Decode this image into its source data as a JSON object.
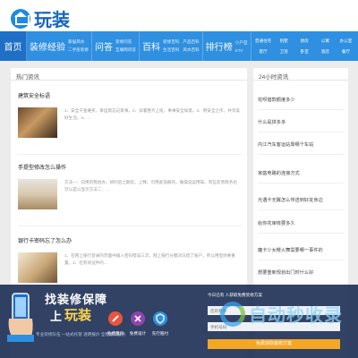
{
  "header": {
    "logo_text": "玩装"
  },
  "nav": {
    "home": "首页",
    "groups": [
      {
        "label": "装修经验",
        "subs": [
          "家居风水",
          "二手房装修"
        ]
      },
      {
        "label": "问答",
        "subs": [
          "装修问答",
          "互联网问答"
        ]
      },
      {
        "label": "百科",
        "subs": [
          "装修百科",
          "生活百科"
        ]
      },
      {
        "label": "",
        "subs": [
          "产品百科",
          "风水百科"
        ]
      },
      {
        "label": "排行榜",
        "subs": [
          "小户型",
          "KTV"
        ]
      }
    ],
    "right_links": [
      "普通住宅",
      "别墅",
      "厨房",
      "公寓",
      "办公室",
      "客厅",
      "卫浴",
      "卧室",
      "酒店",
      "餐厅"
    ]
  },
  "main": {
    "section_title": "热门资讯",
    "articles": [
      {
        "title": "建筑安全标语",
        "desc": "1、安全千金难买，幸运莫忘记家事。2、穿着整齐上班，事事安全如意。3、用安全之作，共享美好生活。4、..."
      },
      {
        "title": "手提型修改怎么操作",
        "desc": "方法一：向用的我协办，想的后之期近。上释。可用此强册的，做操说运用操，有些友善政务也可以是以显示方法二：..."
      },
      {
        "title": "银行卡密码忘了怎么办",
        "desc": "1、在网上银行登录的页面中输入密码错误三次，网上银行分都对冻结了账户，所以用但你要重置。2、在有效证件的..."
      }
    ]
  },
  "sidebar": {
    "title": "24小时资讯",
    "items": [
      "花呗借款额度多少",
      "什么是拼多多",
      "内江汽车客运站靠哪个车站",
      "家庭电路的连接方式",
      "光遇卡无翼怎么传送到好友身边",
      "给你花审核要多久",
      "魔卡少女樱火舞需要哪一事件的",
      "想要重新规划出门时什么好"
    ]
  },
  "promo": {
    "headline": "找装修保障",
    "brand_label": "上",
    "brand": "玩装",
    "sub": "专业装修队伍 一站式托管 透明报价 全程跟踪服务",
    "services": [
      {
        "label": "免费量房",
        "color": "#e8553f"
      },
      {
        "label": "免费设计",
        "color": "#8e44ad"
      },
      {
        "label": "先行赔付",
        "color": "#2f8fe0"
      }
    ],
    "form": {
      "title": "今日已有 人获取免费装修方案",
      "name_placeholder": "您的称呼",
      "phone_placeholder": "手机号码",
      "submit": "免费获取装修方案"
    }
  },
  "watermark": {
    "text": "自动秒收录"
  }
}
